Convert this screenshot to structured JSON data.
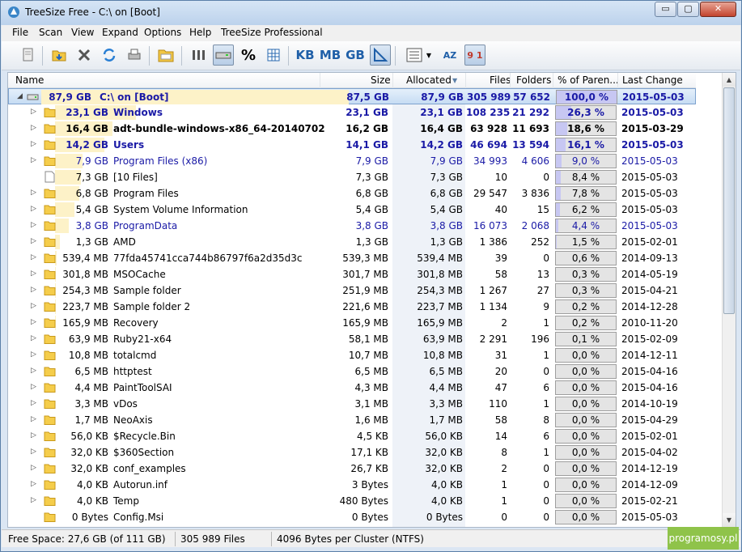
{
  "window": {
    "title": "TreeSize Free - C:\\  on  [Boot]",
    "minimize": "▭",
    "maximize": "▢",
    "close": "✕"
  },
  "menu": [
    "File",
    "Scan",
    "View",
    "Expand",
    "Options",
    "Help",
    "TreeSize Professional"
  ],
  "toolbar": {
    "percent": "%",
    "kb": "KB",
    "mb": "MB",
    "gb": "GB",
    "az": "AZ",
    "num": "9 1"
  },
  "columns": {
    "name": "Name",
    "size": "Size",
    "allocated": "Allocated",
    "files": "Files",
    "folders": "Folders",
    "pct": "% of Paren...",
    "changed": "Last Change"
  },
  "rows": [
    {
      "expander": "◢",
      "label": "87,9 GB",
      "name": "C:\\  on  [Boot]",
      "size": "87,5 GB",
      "alloc": "87,9 GB",
      "files": "305 989",
      "folders": "57 652",
      "pct": "100,0 %",
      "pct_value": 100.0,
      "date": "2015-05-03",
      "bar": 1.0,
      "style": "root"
    },
    {
      "expander": "▷",
      "label": "23,1 GB",
      "name": "Windows",
      "size": "23,1 GB",
      "alloc": "23,1 GB",
      "files": "108 235",
      "folders": "21 292",
      "pct": "26,3 %",
      "pct_value": 26.3,
      "date": "2015-05-03",
      "bar": 0.263,
      "style": "boldblue"
    },
    {
      "expander": "▷",
      "label": "16,4 GB",
      "name": "adt-bundle-windows-x86_64-20140702",
      "size": "16,2 GB",
      "alloc": "16,4 GB",
      "files": "63 928",
      "folders": "11 693",
      "pct": "18,6 %",
      "pct_value": 18.6,
      "date": "2015-03-29",
      "bar": 0.186,
      "style": "bold"
    },
    {
      "expander": "▷",
      "label": "14,2 GB",
      "name": "Users",
      "size": "14,1 GB",
      "alloc": "14,2 GB",
      "files": "46 694",
      "folders": "13 594",
      "pct": "16,1 %",
      "pct_value": 16.1,
      "date": "2015-05-03",
      "bar": 0.161,
      "style": "boldblue"
    },
    {
      "expander": "▷",
      "label": "7,9 GB",
      "name": "Program Files (x86)",
      "size": "7,9 GB",
      "alloc": "7,9 GB",
      "files": "34 993",
      "folders": "4 606",
      "pct": "9,0 %",
      "pct_value": 9.0,
      "date": "2015-05-03",
      "bar": 0.09,
      "style": "blue"
    },
    {
      "expander": "",
      "label": "7,3 GB",
      "name": "[10 Files]",
      "size": "7,3 GB",
      "alloc": "7,3 GB",
      "files": "10",
      "folders": "0",
      "pct": "8,4 %",
      "pct_value": 8.4,
      "date": "2015-05-03",
      "bar": 0.084,
      "style": "file"
    },
    {
      "expander": "▷",
      "label": "6,8 GB",
      "name": "Program Files",
      "size": "6,8 GB",
      "alloc": "6,8 GB",
      "files": "29 547",
      "folders": "3 836",
      "pct": "7,8 %",
      "pct_value": 7.8,
      "date": "2015-05-03",
      "bar": 0.078,
      "style": "normal"
    },
    {
      "expander": "▷",
      "label": "5,4 GB",
      "name": "System Volume Information",
      "size": "5,4 GB",
      "alloc": "5,4 GB",
      "files": "40",
      "folders": "15",
      "pct": "6,2 %",
      "pct_value": 6.2,
      "date": "2015-05-03",
      "bar": 0.062,
      "style": "normal"
    },
    {
      "expander": "▷",
      "label": "3,8 GB",
      "name": "ProgramData",
      "size": "3,8 GB",
      "alloc": "3,8 GB",
      "files": "16 073",
      "folders": "2 068",
      "pct": "4,4 %",
      "pct_value": 4.4,
      "date": "2015-05-03",
      "bar": 0.044,
      "style": "blue"
    },
    {
      "expander": "▷",
      "label": "1,3 GB",
      "name": "AMD",
      "size": "1,3 GB",
      "alloc": "1,3 GB",
      "files": "1 386",
      "folders": "252",
      "pct": "1,5 %",
      "pct_value": 1.5,
      "date": "2015-02-01",
      "bar": 0.015,
      "style": "normal"
    },
    {
      "expander": "▷",
      "label": "539,4 MB",
      "name": "77fda45741cca744b86797f6a2d35d3c",
      "size": "539,3 MB",
      "alloc": "539,4 MB",
      "files": "39",
      "folders": "0",
      "pct": "0,6 %",
      "pct_value": 0.6,
      "date": "2014-09-13",
      "bar": 0.006,
      "style": "normal"
    },
    {
      "expander": "▷",
      "label": "301,8 MB",
      "name": "MSOCache",
      "size": "301,7 MB",
      "alloc": "301,8 MB",
      "files": "58",
      "folders": "13",
      "pct": "0,3 %",
      "pct_value": 0.3,
      "date": "2014-05-19",
      "bar": 0.003,
      "style": "normal"
    },
    {
      "expander": "▷",
      "label": "254,3 MB",
      "name": "Sample folder",
      "size": "251,9 MB",
      "alloc": "254,3 MB",
      "files": "1 267",
      "folders": "27",
      "pct": "0,3 %",
      "pct_value": 0.3,
      "date": "2015-04-21",
      "bar": 0.003,
      "style": "normal"
    },
    {
      "expander": "▷",
      "label": "223,7 MB",
      "name": "Sample folder 2",
      "size": "221,6 MB",
      "alloc": "223,7 MB",
      "files": "1 134",
      "folders": "9",
      "pct": "0,2 %",
      "pct_value": 0.2,
      "date": "2014-12-28",
      "bar": 0.002,
      "style": "normal"
    },
    {
      "expander": "▷",
      "label": "165,9 MB",
      "name": "Recovery",
      "size": "165,9 MB",
      "alloc": "165,9 MB",
      "files": "2",
      "folders": "1",
      "pct": "0,2 %",
      "pct_value": 0.2,
      "date": "2010-11-20",
      "bar": 0.002,
      "style": "normal"
    },
    {
      "expander": "▷",
      "label": "63,9 MB",
      "name": "Ruby21-x64",
      "size": "58,1 MB",
      "alloc": "63,9 MB",
      "files": "2 291",
      "folders": "196",
      "pct": "0,1 %",
      "pct_value": 0.1,
      "date": "2015-02-09",
      "bar": 0.001,
      "style": "normal"
    },
    {
      "expander": "▷",
      "label": "10,8 MB",
      "name": "totalcmd",
      "size": "10,7 MB",
      "alloc": "10,8 MB",
      "files": "31",
      "folders": "1",
      "pct": "0,0 %",
      "pct_value": 0.0,
      "date": "2014-12-11",
      "bar": 0,
      "style": "normal"
    },
    {
      "expander": "▷",
      "label": "6,5 MB",
      "name": "httptest",
      "size": "6,5 MB",
      "alloc": "6,5 MB",
      "files": "20",
      "folders": "0",
      "pct": "0,0 %",
      "pct_value": 0.0,
      "date": "2015-04-16",
      "bar": 0,
      "style": "normal"
    },
    {
      "expander": "▷",
      "label": "4,4 MB",
      "name": "PaintToolSAI",
      "size": "4,3 MB",
      "alloc": "4,4 MB",
      "files": "47",
      "folders": "6",
      "pct": "0,0 %",
      "pct_value": 0.0,
      "date": "2015-04-16",
      "bar": 0,
      "style": "normal"
    },
    {
      "expander": "▷",
      "label": "3,3 MB",
      "name": "vDos",
      "size": "3,1 MB",
      "alloc": "3,3 MB",
      "files": "110",
      "folders": "1",
      "pct": "0,0 %",
      "pct_value": 0.0,
      "date": "2014-10-19",
      "bar": 0,
      "style": "normal"
    },
    {
      "expander": "▷",
      "label": "1,7 MB",
      "name": "NeoAxis",
      "size": "1,6 MB",
      "alloc": "1,7 MB",
      "files": "58",
      "folders": "8",
      "pct": "0,0 %",
      "pct_value": 0.0,
      "date": "2015-04-29",
      "bar": 0,
      "style": "normal"
    },
    {
      "expander": "▷",
      "label": "56,0 KB",
      "name": "$Recycle.Bin",
      "size": "4,5 KB",
      "alloc": "56,0 KB",
      "files": "14",
      "folders": "6",
      "pct": "0,0 %",
      "pct_value": 0.0,
      "date": "2015-02-01",
      "bar": 0,
      "style": "normal"
    },
    {
      "expander": "▷",
      "label": "32,0 KB",
      "name": "$360Section",
      "size": "17,1 KB",
      "alloc": "32,0 KB",
      "files": "8",
      "folders": "1",
      "pct": "0,0 %",
      "pct_value": 0.0,
      "date": "2015-04-02",
      "bar": 0,
      "style": "normal"
    },
    {
      "expander": "▷",
      "label": "32,0 KB",
      "name": "conf_examples",
      "size": "26,7 KB",
      "alloc": "32,0 KB",
      "files": "2",
      "folders": "0",
      "pct": "0,0 %",
      "pct_value": 0.0,
      "date": "2014-12-19",
      "bar": 0,
      "style": "normal"
    },
    {
      "expander": "▷",
      "label": "4,0 KB",
      "name": "Autorun.inf",
      "size": "3 Bytes",
      "alloc": "4,0 KB",
      "files": "1",
      "folders": "0",
      "pct": "0,0 %",
      "pct_value": 0.0,
      "date": "2014-12-09",
      "bar": 0,
      "style": "normal"
    },
    {
      "expander": "▷",
      "label": "4,0 KB",
      "name": "Temp",
      "size": "480 Bytes",
      "alloc": "4,0 KB",
      "files": "1",
      "folders": "0",
      "pct": "0,0 %",
      "pct_value": 0.0,
      "date": "2015-02-21",
      "bar": 0,
      "style": "normal"
    },
    {
      "expander": "",
      "label": "0 Bytes",
      "name": "Config.Msi",
      "size": "0 Bytes",
      "alloc": "0 Bytes",
      "files": "0",
      "folders": "0",
      "pct": "0,0 %",
      "pct_value": 0.0,
      "date": "2015-05-03",
      "bar": 0,
      "style": "normal"
    }
  ],
  "status": {
    "free": "Free Space: 27,6 GB  (of 111 GB)",
    "files": "305 989  Files",
    "cluster": "4096 Bytes per Cluster (NTFS)"
  },
  "watermark": "programosy.pl",
  "colors": {
    "blue": "#1a1aa6",
    "barfill": "#fdf2c8",
    "pctfill": "#c7c7f2",
    "accent": "#7da2ce"
  }
}
